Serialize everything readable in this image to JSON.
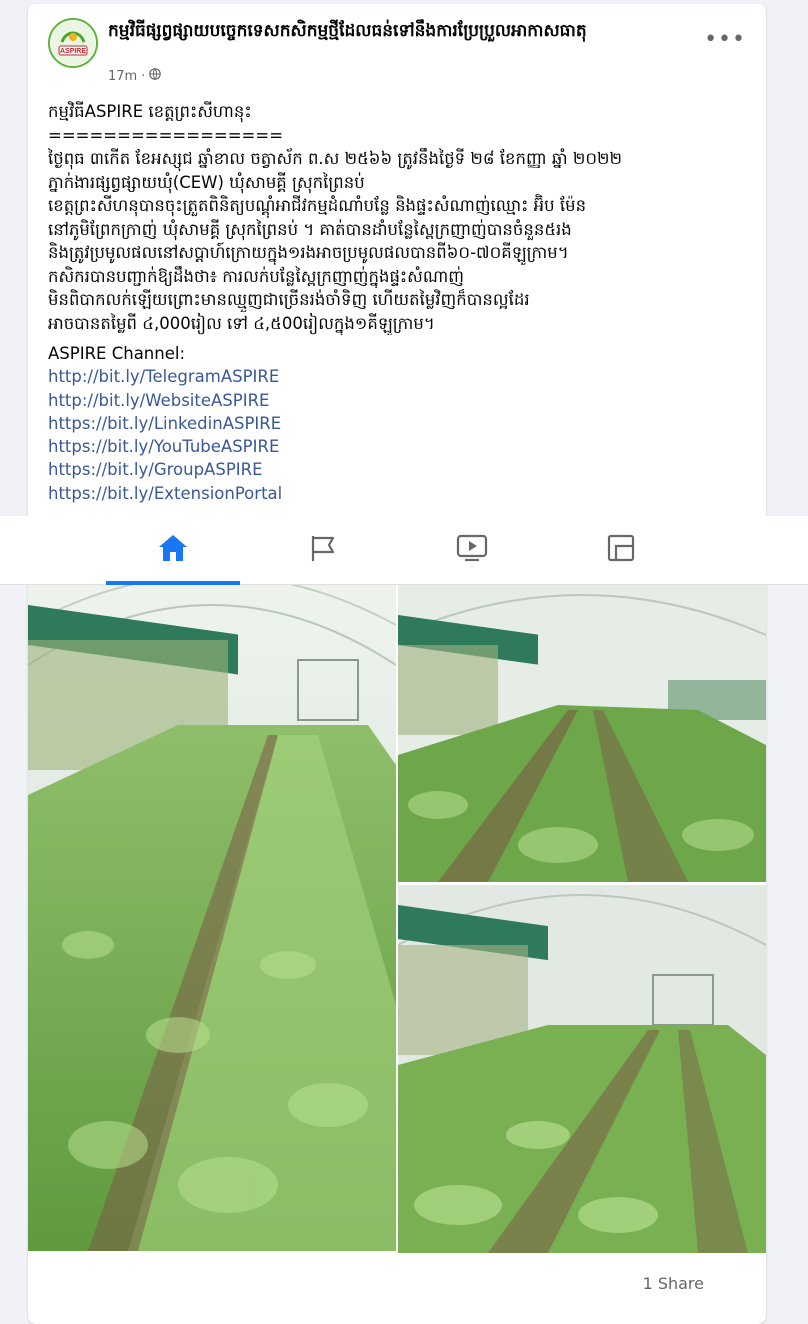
{
  "post": {
    "page_name": "កម្មវិធីផ្សព្វផ្សាយបច្ចេកទេសកសិកម្មថ្មីដែលធន់ទៅនឹងការប្រែប្រួលអាកាសធាតុ",
    "avatar_text": "ASPIRE",
    "time": "17m",
    "privacy_icon": "globe-icon",
    "more_icon": "more-options-icon",
    "more_label": "•••",
    "lines": [
      "កម្មវិធីASPIRE ខេត្តព្រះសីហានុះ",
      "=================",
      "ថ្ងៃពុធ ៣កើត ខែអស្សុជ ឆ្នាំខាល ចត្វាស័ក ព.ស ២៥៦៦ ត្រូវនឹងថ្ងៃទី ២៨ ខែកញ្ញា ឆ្នាំ ២០២២",
      "ភ្នាក់ងារផ្សព្វផ្សាយឃុំ(CEW) ឃុំសាមគ្គី ស្រុកព្រៃនប់",
      "ខេត្តព្រះសីហនុបានចុះត្រួតពិនិត្យបណ្តុំអាជីវកម្មដំណាំបន្លែ និងផ្ទះសំណាញ់ឈ្មោះ អ៊ិប ម៉ែន",
      "នៅភូមិព្រែកក្រាញ់ ឃុំសាមគ្គី ស្រុកព្រៃនប់ ។ គាត់បានដាំបន្លែស្ពៃក្រញាញ់បានចំនួន៥រង",
      "និងត្រូវប្រមូលផលនៅសប្តាហ៍ក្រោយក្នុង១រងអាចប្រមូលផលបានពី៦០-៧០គីឡូក្រាម។",
      "កសិករបានបញ្ជាក់ឱ្យដឹងថា៖ ការលក់បន្លែស្ពៃក្រញាញ់ក្នុងផ្ទះសំណាញ់",
      "មិនពិបាកលក់ឡើយព្រោះមានឈ្មួញជាច្រើនរង់ចាំទិញ ហើយតម្លៃវិញក៏បានល្អដែរ",
      "អាចបានតម្លៃពី ៤,000រៀល ទៅ ៤,៥00រៀលក្នុង១គីឡូក្រាម។"
    ],
    "channel_label": "ASPIRE Channel:",
    "links": [
      "http://bit.ly/TelegramASPIRE",
      "http://bit.ly/WebsiteASPIRE",
      "https://bit.ly/LinkedinASPIRE",
      "https://bit.ly/YouTubeASPIRE",
      "https://bit.ly/GroupASPIRE",
      "https://bit.ly/ExtensionPortal"
    ],
    "share_count": "1 Share"
  },
  "nav": {
    "tabs": [
      {
        "name": "home",
        "icon": "home-icon",
        "active": true
      },
      {
        "name": "pages",
        "icon": "flag-icon",
        "active": false
      },
      {
        "name": "watch",
        "icon": "video-icon",
        "active": false
      },
      {
        "name": "marketplace",
        "icon": "marketplace-icon",
        "active": false
      }
    ]
  },
  "photos": [
    {
      "name": "greenhouse-photo-1",
      "subject": "pak choi rows in greenhouse"
    },
    {
      "name": "greenhouse-photo-2",
      "subject": "pak choi rows in greenhouse"
    },
    {
      "name": "greenhouse-photo-3",
      "subject": "pak choi rows in greenhouse"
    }
  ],
  "colors": {
    "link": "#385898",
    "accent": "#1877f2",
    "meta": "#65676b",
    "avatar_ring": "#5fb338"
  }
}
